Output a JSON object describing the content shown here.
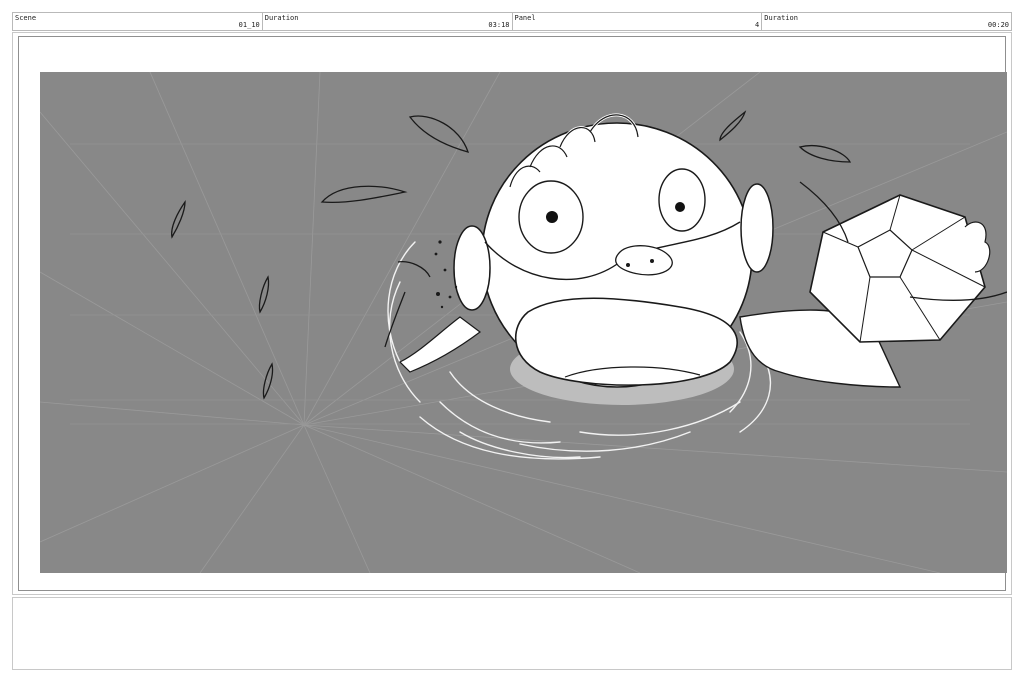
{
  "header": {
    "cells": [
      {
        "label": "Scene",
        "value": "01_10"
      },
      {
        "label": "Duration",
        "value": "03:18"
      },
      {
        "label": "Panel",
        "value": "4"
      },
      {
        "label": "Duration",
        "value": "00:20"
      }
    ]
  },
  "panel": {
    "background_color": "#888888",
    "line_color": "#ffffff",
    "ink_color": "#1a1a1a"
  },
  "notes": {
    "text": ""
  }
}
